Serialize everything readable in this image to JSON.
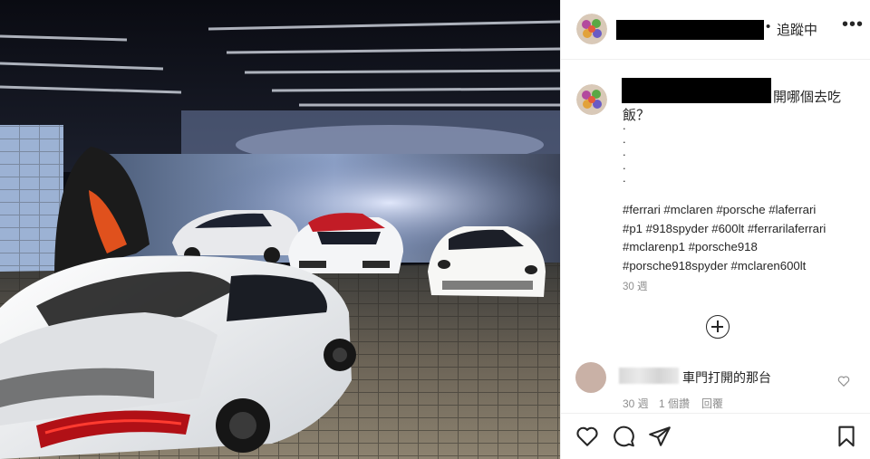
{
  "post": {
    "username_redacted": true,
    "follow_label": "追蹤中",
    "follow_separator": "•",
    "more_label": "•••",
    "caption": {
      "first_line_tail": "開哪個去吃",
      "second_line": "飯？",
      "dots": [
        ".",
        ".",
        ".",
        ".",
        "."
      ],
      "hashtag_lines": [
        "#ferrari #mclaren #porsche #laferrari",
        "#p1 #918spyder #600lt #ferrarilaferrari",
        "#mclarenp1 #porsche918",
        "#porsche918spyder #mclaren600lt"
      ],
      "age": "30 週"
    },
    "load_more_icon": "plus-circle-icon",
    "comment": {
      "text": "車門打開的那台",
      "age": "30 週",
      "likes": "1 個讚",
      "reply": "回覆"
    },
    "actions": {
      "like_icon": "heart-icon",
      "comment_icon": "comment-icon",
      "share_icon": "paper-plane-icon",
      "save_icon": "bookmark-icon"
    }
  },
  "colors": {
    "text": "#262626",
    "secondary": "#8e8e8e",
    "border": "#efefef",
    "redaction": "#000000"
  }
}
